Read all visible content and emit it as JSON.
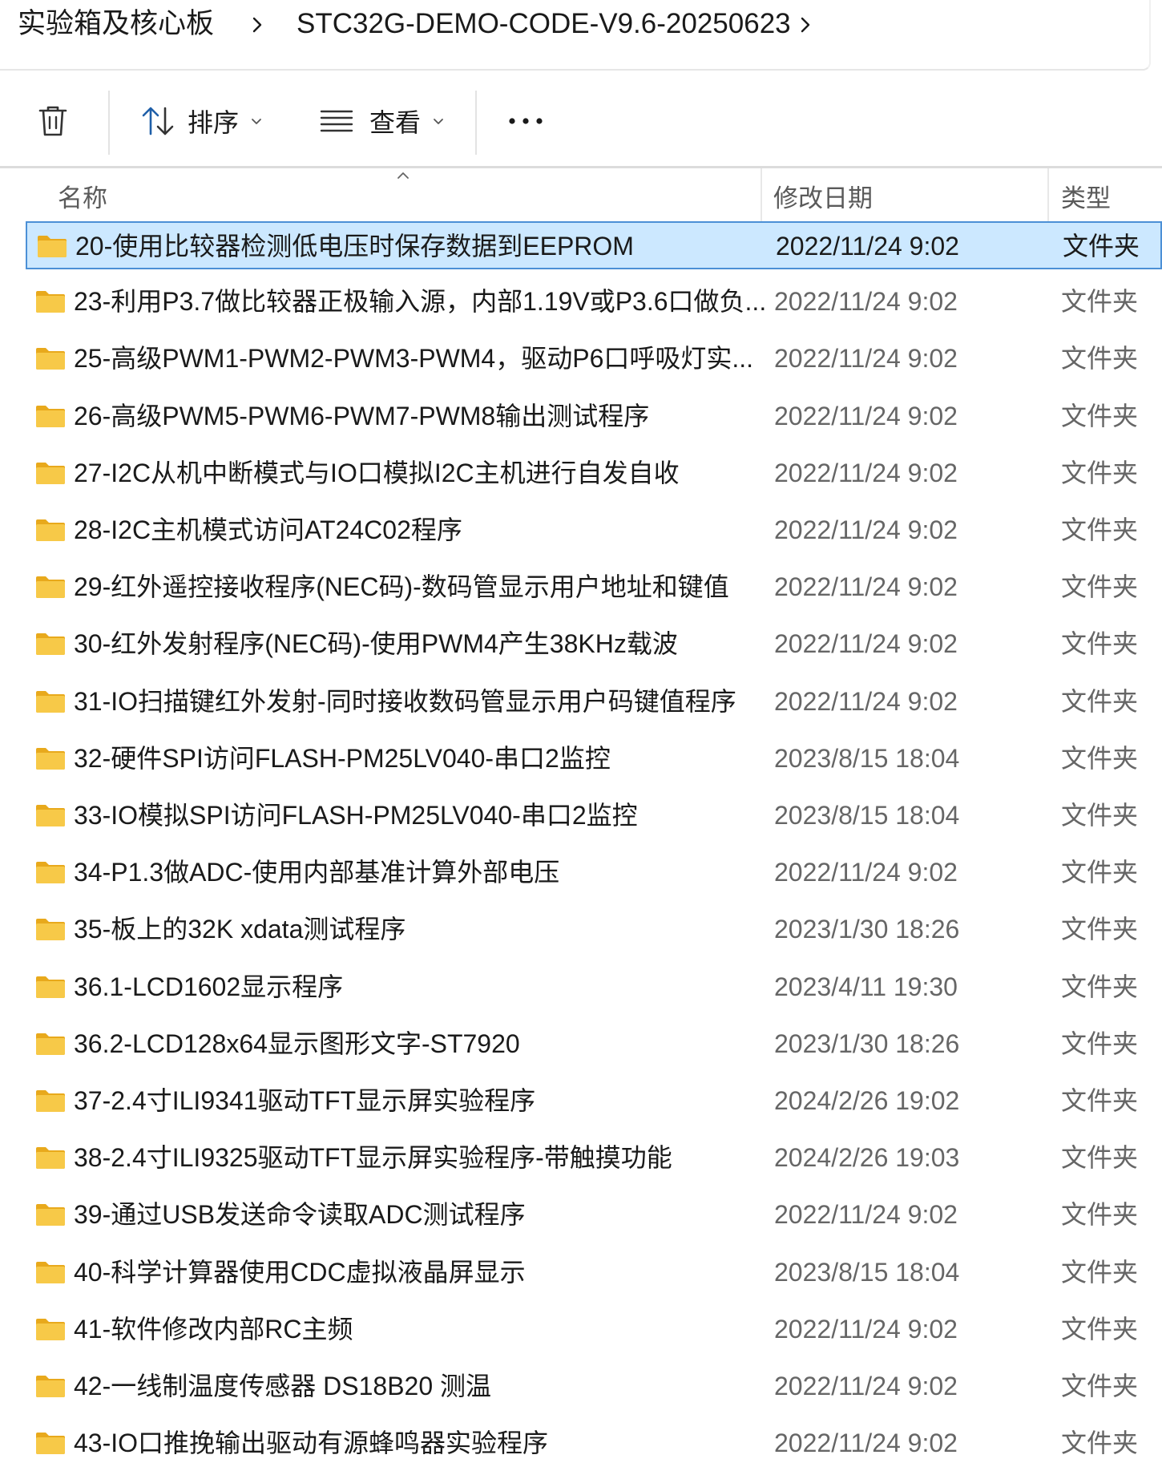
{
  "breadcrumb": {
    "items": [
      {
        "label": "实验箱及核心板"
      },
      {
        "label": "STC32G-DEMO-CODE-V9.6-20250623"
      }
    ]
  },
  "toolbar": {
    "delete_icon": "trash-icon",
    "sort_label": "排序",
    "view_label": "查看",
    "more_icon": "ellipsis-icon"
  },
  "columns": {
    "name": "名称",
    "date": "修改日期",
    "type": "类型"
  },
  "colors": {
    "selection_bg": "#cce8ff",
    "selection_border": "#4c90d6",
    "folder_yellow": "#f7c948"
  },
  "files": [
    {
      "name": "20-使用比较器检测低电压时保存数据到EEPROM",
      "date": "2022/11/24 9:02",
      "type": "文件夹",
      "selected": true
    },
    {
      "name": "23-利用P3.7做比较器正极输入源，内部1.19V或P3.6口做负...",
      "date": "2022/11/24 9:02",
      "type": "文件夹"
    },
    {
      "name": "25-高级PWM1-PWM2-PWM3-PWM4，驱动P6口呼吸灯实...",
      "date": "2022/11/24 9:02",
      "type": "文件夹"
    },
    {
      "name": "26-高级PWM5-PWM6-PWM7-PWM8输出测试程序",
      "date": "2022/11/24 9:02",
      "type": "文件夹"
    },
    {
      "name": "27-I2C从机中断模式与IO口模拟I2C主机进行自发自收",
      "date": "2022/11/24 9:02",
      "type": "文件夹"
    },
    {
      "name": "28-I2C主机模式访问AT24C02程序",
      "date": "2022/11/24 9:02",
      "type": "文件夹"
    },
    {
      "name": "29-红外遥控接收程序(NEC码)-数码管显示用户地址和键值",
      "date": "2022/11/24 9:02",
      "type": "文件夹"
    },
    {
      "name": "30-红外发射程序(NEC码)-使用PWM4产生38KHz载波",
      "date": "2022/11/24 9:02",
      "type": "文件夹"
    },
    {
      "name": "31-IO扫描键红外发射-同时接收数码管显示用户码键值程序",
      "date": "2022/11/24 9:02",
      "type": "文件夹"
    },
    {
      "name": "32-硬件SPI访问FLASH-PM25LV040-串口2监控",
      "date": "2023/8/15 18:04",
      "type": "文件夹"
    },
    {
      "name": "33-IO模拟SPI访问FLASH-PM25LV040-串口2监控",
      "date": "2023/8/15 18:04",
      "type": "文件夹"
    },
    {
      "name": "34-P1.3做ADC-使用内部基准计算外部电压",
      "date": "2022/11/24 9:02",
      "type": "文件夹"
    },
    {
      "name": "35-板上的32K xdata测试程序",
      "date": "2023/1/30 18:26",
      "type": "文件夹"
    },
    {
      "name": "36.1-LCD1602显示程序",
      "date": "2023/4/11 19:30",
      "type": "文件夹"
    },
    {
      "name": "36.2-LCD128x64显示图形文字-ST7920",
      "date": "2023/1/30 18:26",
      "type": "文件夹"
    },
    {
      "name": "37-2.4寸ILI9341驱动TFT显示屏实验程序",
      "date": "2024/2/26 19:02",
      "type": "文件夹"
    },
    {
      "name": "38-2.4寸ILI9325驱动TFT显示屏实验程序-带触摸功能",
      "date": "2024/2/26 19:03",
      "type": "文件夹"
    },
    {
      "name": "39-通过USB发送命令读取ADC测试程序",
      "date": "2022/11/24 9:02",
      "type": "文件夹"
    },
    {
      "name": "40-科学计算器使用CDC虚拟液晶屏显示",
      "date": "2023/8/15 18:04",
      "type": "文件夹"
    },
    {
      "name": "41-软件修改内部RC主频",
      "date": "2022/11/24 9:02",
      "type": "文件夹"
    },
    {
      "name": "42-一线制温度传感器 DS18B20 测温",
      "date": "2022/11/24 9:02",
      "type": "文件夹"
    },
    {
      "name": "43-IO口推挽输出驱动有源蜂鸣器实验程序",
      "date": "2022/11/24 9:02",
      "type": "文件夹"
    }
  ]
}
